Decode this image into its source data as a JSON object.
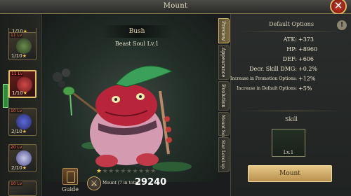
{
  "window": {
    "title": "Mount"
  },
  "left_list": {
    "top_partial_count": "1/10",
    "cards": [
      {
        "level": "11 Lv",
        "count": "1/10",
        "selected": false
      },
      {
        "level": "11 Lv",
        "count": "1/10",
        "selected": true
      },
      {
        "level": "10 Lv",
        "count": "2/10",
        "selected": false
      },
      {
        "level": "20 Lv",
        "count": "2/10",
        "selected": false
      },
      {
        "level": "10 Lv",
        "count": "",
        "selected": false
      }
    ]
  },
  "mount": {
    "name": "Bush",
    "soul": "Beast Soul Lv.1"
  },
  "bottom": {
    "guide_label": "Guide",
    "stars_filled": 1,
    "stars_total": 10,
    "power_label": "Mount (7 in total)",
    "power_value": "29240"
  },
  "tabs": [
    {
      "label": "Preview",
      "active": true
    },
    {
      "label": "Appearance",
      "active": false
    },
    {
      "label": "Evolution",
      "active": false
    },
    {
      "label": "Mount Soul",
      "active": false
    },
    {
      "label": "Star Level-up",
      "active": false
    }
  ],
  "panel": {
    "title": "Default Options",
    "stats": [
      {
        "key": "ATK:",
        "value": "+373"
      },
      {
        "key": "HP:",
        "value": "+8960"
      },
      {
        "key": "DEF:",
        "value": "+606"
      },
      {
        "key": "Decr. Skill DMG:",
        "value": "+0.2%"
      },
      {
        "key": "Increase in Promotion Options:",
        "value": "+12%"
      },
      {
        "key": "Increase in Default Options:",
        "value": "+5%"
      }
    ],
    "skill_title": "Skill",
    "skill_level": "Lv.1",
    "mount_button": "Mount"
  },
  "colors": {
    "accent_gold": "#e2c266",
    "star_gold": "#f2c44a",
    "close_red": "#c23a2a"
  }
}
